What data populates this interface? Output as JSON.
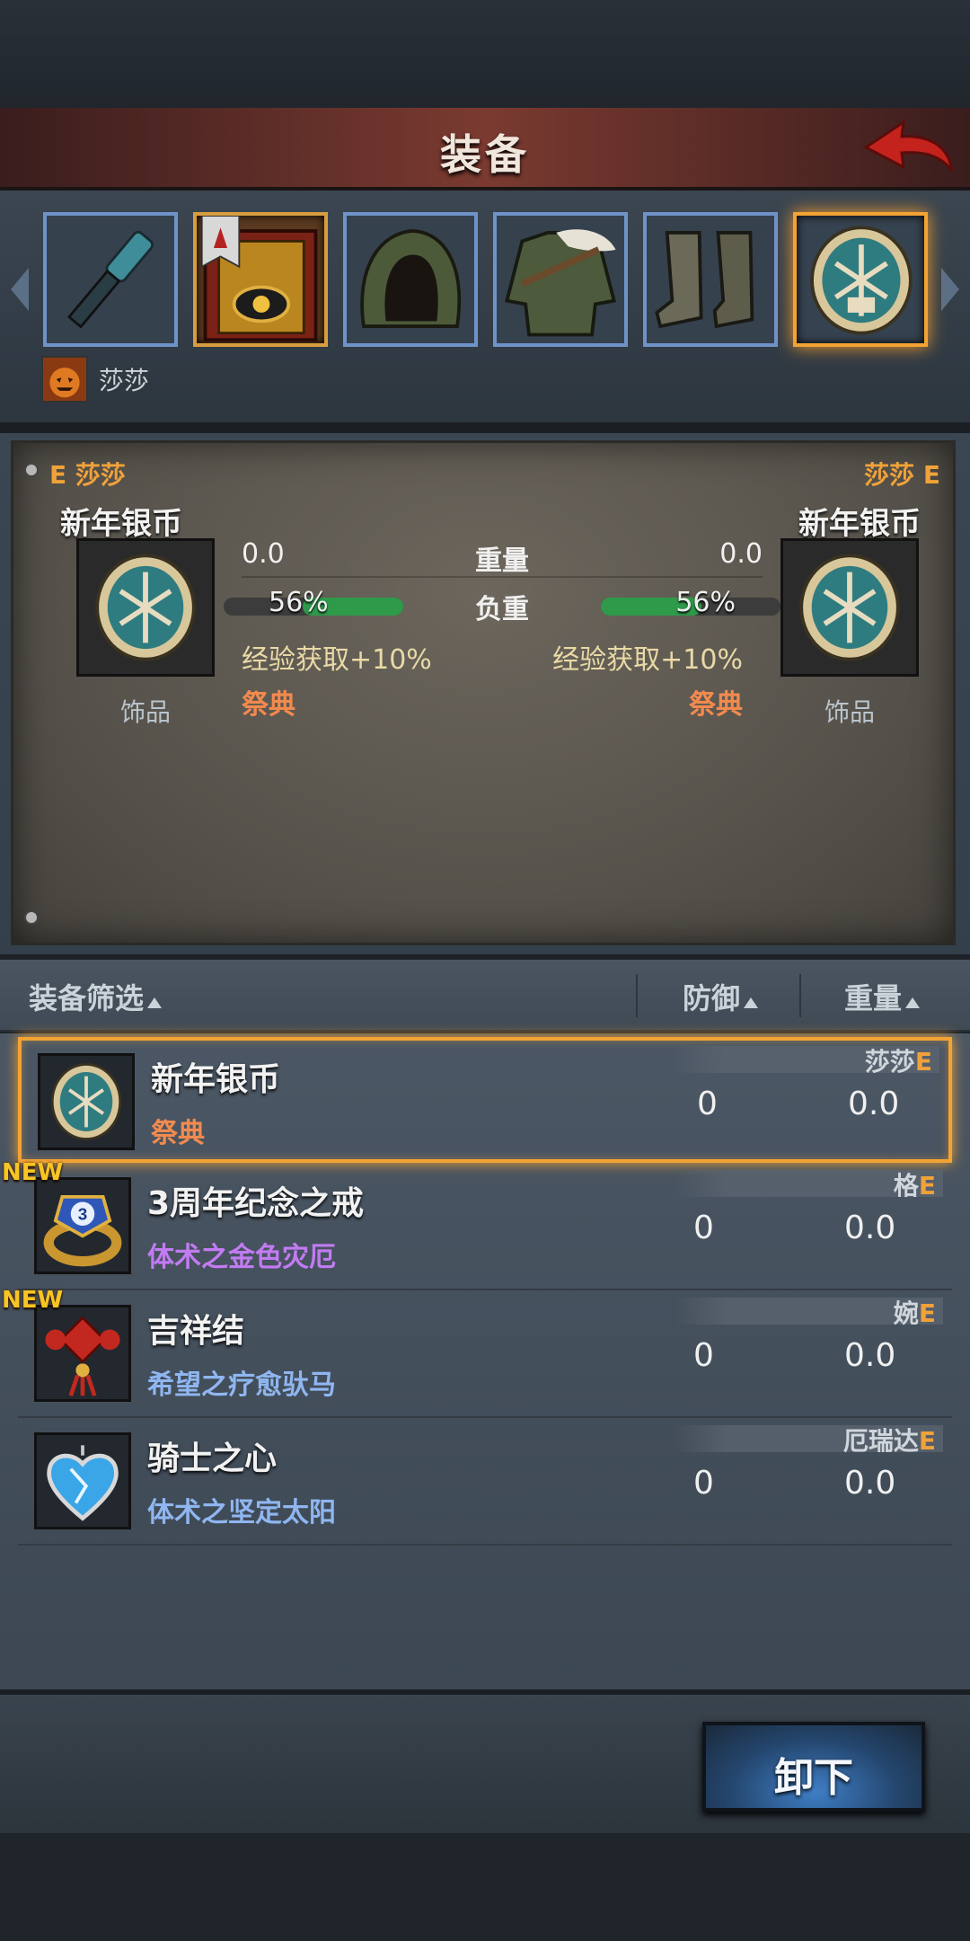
{
  "header": {
    "title": "装备"
  },
  "equipment_slots": [
    {
      "name": "mace-icon",
      "style": "blue"
    },
    {
      "name": "tome-icon",
      "style": "gold"
    },
    {
      "name": "hood-icon",
      "style": "blue"
    },
    {
      "name": "tunic-icon",
      "style": "blue"
    },
    {
      "name": "boots-icon",
      "style": "blue"
    },
    {
      "name": "silver-coin-icon",
      "style": "selected"
    }
  ],
  "character": {
    "name": "莎莎",
    "icon": "pumpkin-avatar-icon"
  },
  "compare": {
    "left": {
      "owner": "E 莎莎",
      "name": "新年银币",
      "type": "饰品",
      "weight": "0.0",
      "load_percent": 56,
      "load_text": "56%",
      "bonus": "经验获取+10%",
      "tag": "祭典"
    },
    "right": {
      "owner": "莎莎 E",
      "name": "新年银币",
      "type": "饰品",
      "weight": "0.0",
      "load_percent": 56,
      "load_text": "56%",
      "bonus": "经验获取+10%",
      "tag": "祭典"
    },
    "labels": {
      "weight": "重量",
      "load": "负重"
    }
  },
  "list_header": {
    "filter": "装备筛选",
    "defense": "防御",
    "weight": "重量"
  },
  "items": [
    {
      "name": "新年银币",
      "sub": "祭典",
      "sub_color": "#f28a4e",
      "owner": "莎莎",
      "owner_mark": "E",
      "defense": "0",
      "weight": "0.0",
      "icon": "silver-coin-icon",
      "new": "",
      "selected": true
    },
    {
      "name": "3周年纪念之戒",
      "sub": "体术之金色灾厄",
      "sub_color": "#c27bf2",
      "owner": "格",
      "owner_mark": "E",
      "defense": "0",
      "weight": "0.0",
      "icon": "anniversary-ring-icon",
      "new": "NEW",
      "selected": false
    },
    {
      "name": "吉祥结",
      "sub": "希望之疗愈驮马",
      "sub_color": "#8fb6f0",
      "owner": "婉",
      "owner_mark": "E",
      "defense": "0",
      "weight": "0.0",
      "icon": "lucky-knot-icon",
      "new": "NEW",
      "selected": false
    },
    {
      "name": "骑士之心",
      "sub": "体术之坚定太阳",
      "sub_color": "#8fb6f0",
      "owner": "厄瑞达",
      "owner_mark": "E",
      "defense": "0",
      "weight": "0.0",
      "icon": "knight-heart-icon",
      "new": "",
      "selected": false
    }
  ],
  "actions": {
    "unequip": "卸下"
  }
}
